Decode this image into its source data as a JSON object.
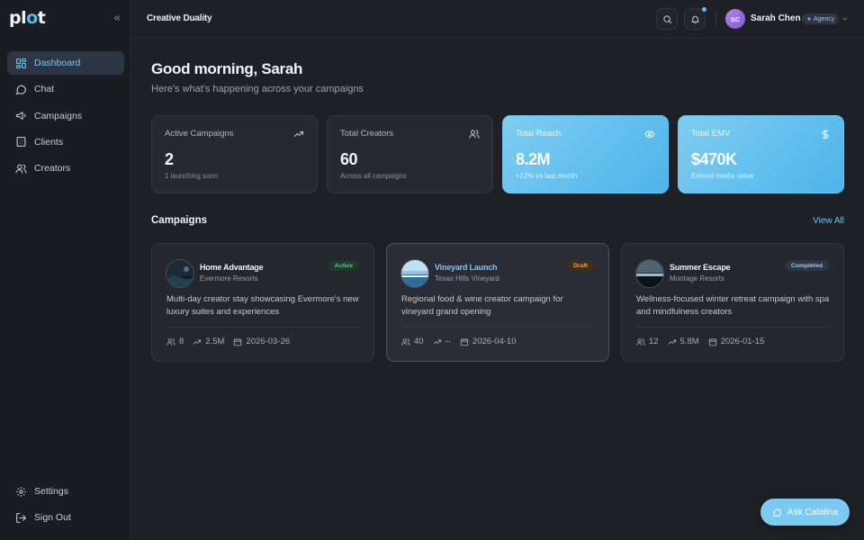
{
  "app": {
    "logo_text": "pl",
    "logo_dot": "o",
    "logo_end": "t",
    "accent": "#63c0f0"
  },
  "sidebar": {
    "items": [
      {
        "label": "Dashboard",
        "icon": "dashboard-icon",
        "active": true
      },
      {
        "label": "Chat",
        "icon": "chat-icon"
      },
      {
        "label": "Campaigns",
        "icon": "megaphone-icon"
      },
      {
        "label": "Clients",
        "icon": "building-icon"
      },
      {
        "label": "Creators",
        "icon": "users-icon"
      }
    ],
    "bottom": [
      {
        "label": "Settings",
        "icon": "gear-icon"
      },
      {
        "label": "Sign Out",
        "icon": "sign-out-icon"
      }
    ]
  },
  "header": {
    "org": "Creative Duality",
    "user": {
      "initials": "SC",
      "name": "Sarah Chen",
      "role": "Agency"
    }
  },
  "greeting": {
    "title": "Good morning, Sarah",
    "subtitle": "Here's what's happening across your campaigns"
  },
  "stats": [
    {
      "label": "Active Campaigns",
      "value": "2",
      "sub": "1 launching soon",
      "icon": "trending-up-icon"
    },
    {
      "label": "Total Creators",
      "value": "60",
      "sub": "Across all campaigns",
      "icon": "users-icon"
    },
    {
      "label": "Total Reach",
      "value": "8.2M",
      "sub": "+12% vs last month",
      "icon": "eye-icon"
    },
    {
      "label": "Total EMV",
      "value": "$470K",
      "sub": "Earned media value",
      "icon": "dollar-icon"
    }
  ],
  "campaigns_section": {
    "title": "Campaigns",
    "view_all": "View All"
  },
  "campaigns": [
    {
      "name": "Home Advantage",
      "client": "Evermore Resorts",
      "status": "Active",
      "description": "Multi-day creator stay showcasing Evermore's new luxury suites and experiences",
      "creators": "8",
      "reach": "2.5M",
      "date": "2026-03-26"
    },
    {
      "name": "Vineyard Launch",
      "client": "Texas Hills Vineyard",
      "status": "Draft",
      "description": "Regional food & wine creator campaign for vineyard grand opening",
      "creators": "40",
      "reach": "--",
      "date": "2026-04-10"
    },
    {
      "name": "Summer Escape",
      "client": "Montage Resorts",
      "status": "Completed",
      "description": "Wellness-focused winter retreat campaign with spa and mindfulness creators",
      "creators": "12",
      "reach": "5.8M",
      "date": "2026-01-15"
    }
  ],
  "assistant": {
    "label": "Ask Catalina",
    "icon": "chat-icon"
  }
}
